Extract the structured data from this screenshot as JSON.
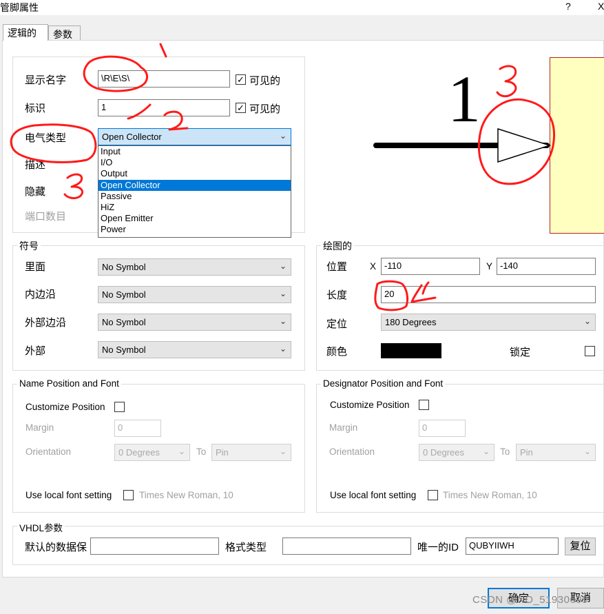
{
  "window": {
    "title": "管脚属性",
    "help": "?",
    "close": "X"
  },
  "tabs": [
    {
      "label": "逻辑的"
    },
    {
      "label": "参数"
    }
  ],
  "logical": {
    "display_name_label": "显示名字",
    "display_name_value": "\\R\\E\\S\\",
    "designator_label": "标识",
    "designator_value": "1",
    "visible_label": "可见的",
    "electrical_type_label": "电气类型",
    "electrical_type_value": "Open Collector",
    "electrical_type_options": [
      "Input",
      "I/O",
      "Output",
      "Open Collector",
      "Passive",
      "HiZ",
      "Open Emitter",
      "Power"
    ],
    "description_label": "描述",
    "hide_label": "隐藏",
    "port_count_label": "端口数目"
  },
  "preview": {
    "pin_number": "1"
  },
  "symbols": {
    "group_label": "符号",
    "inside_label": "里面",
    "inside_edge_label": "内边沿",
    "outside_edge_label": "外部边沿",
    "outside_label": "外部",
    "no_symbol": "No Symbol"
  },
  "graphical": {
    "group_label": "绘图的",
    "location_label": "位置",
    "x_label": "X",
    "x_value": "-110",
    "y_label": "Y",
    "y_value": "-140",
    "length_label": "长度",
    "length_value": "20",
    "orientation_label": "定位",
    "orientation_value": "180 Degrees",
    "color_label": "颜色",
    "color_value": "#000000",
    "locked_label": "锁定"
  },
  "name_position": {
    "group_label": "Name Position and Font",
    "customize_label": "Customize Position",
    "margin_label": "Margin",
    "margin_value": "0",
    "orientation_label": "Orientation",
    "orientation_value": "0 Degrees",
    "to_label": "To",
    "to_value": "Pin",
    "font_label": "Use local font setting",
    "font_value": "Times New Roman, 10"
  },
  "designator_position": {
    "group_label": "Designator Position and Font",
    "customize_label": "Customize Position",
    "margin_label": "Margin",
    "margin_value": "0",
    "orientation_label": "Orientation",
    "orientation_value": "0 Degrees",
    "to_label": "To",
    "to_value": "Pin",
    "font_label": "Use local font setting",
    "font_value": "Times New Roman, 10"
  },
  "vhdl": {
    "group_label": "VHDL参数",
    "default_label": "默认的数据保",
    "default_value": "",
    "format_label": "格式类型",
    "format_value": "",
    "unique_id_label": "唯一的ID",
    "unique_id_value": "QUBYIIWH",
    "reset_label": "复位"
  },
  "buttons": {
    "ok": "确定",
    "cancel": "取消"
  },
  "annotations": [
    "1",
    "2",
    "3",
    "3",
    "4"
  ],
  "watermark": "CSDN @NO_51930699",
  "colors": {
    "accent": "#0078d7",
    "ink": "#ff0000",
    "component_fill": "#ffffc0",
    "component_border": "#b22222"
  }
}
